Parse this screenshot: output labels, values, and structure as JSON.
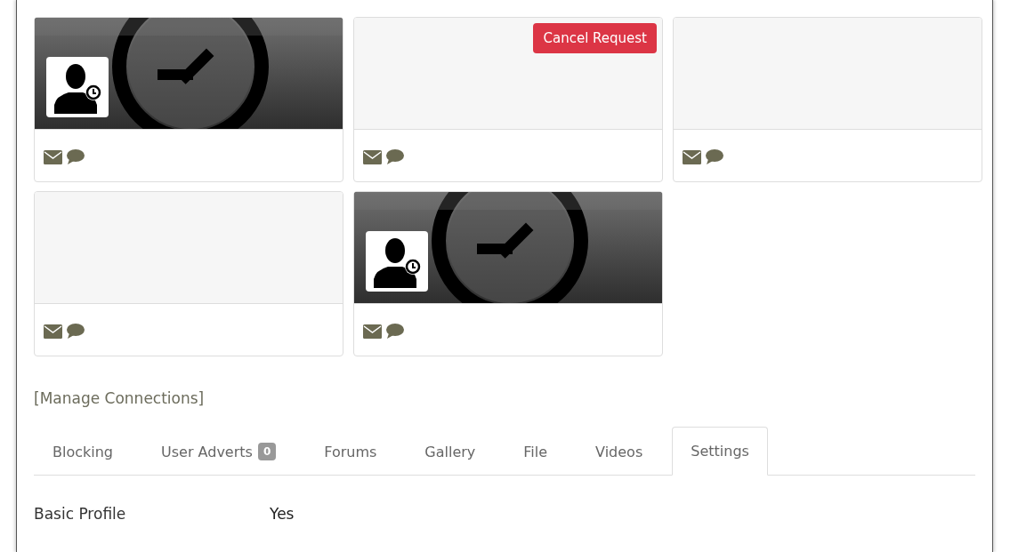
{
  "connections": [
    {
      "kind": "picture",
      "avatar": true
    },
    {
      "kind": "empty",
      "action": "Cancel Request"
    },
    {
      "kind": "empty"
    },
    {
      "kind": "empty"
    },
    {
      "kind": "picture",
      "avatar": true
    }
  ],
  "manage_link": "[Manage Connections]",
  "tabs": [
    {
      "label": "Blocking",
      "selected": false
    },
    {
      "label": "User Adverts",
      "badge": "0",
      "selected": false
    },
    {
      "label": "Forums",
      "selected": false
    },
    {
      "label": "Gallery",
      "selected": false
    },
    {
      "label": "File",
      "selected": false
    },
    {
      "label": "Videos",
      "selected": false
    },
    {
      "label": "Settings",
      "selected": true
    }
  ],
  "settings": [
    {
      "label": "Basic Profile",
      "value": "Yes"
    }
  ]
}
